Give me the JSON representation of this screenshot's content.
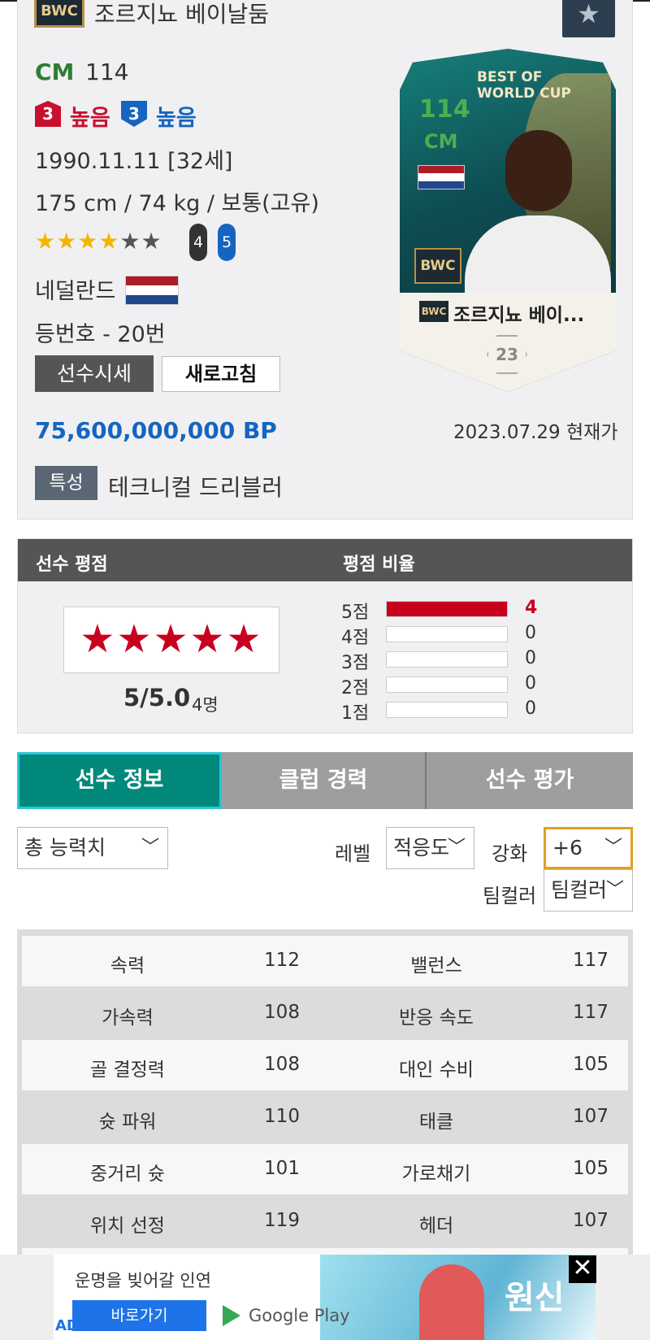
{
  "player": {
    "season_badge": "BWC",
    "name": "조르지뇨 베이날둠",
    "position": "CM",
    "ovr": "114",
    "work_rate_attack": {
      "level": "3",
      "label": "높음"
    },
    "work_rate_defense": {
      "level": "3",
      "label": "높음"
    },
    "birth": "1990.11.11 [32세]",
    "physique": "175 cm / 74 kg / 보통(고유)",
    "skill_stars_filled": 4,
    "skill_stars_total": 6,
    "weak_foot_left": "4",
    "weak_foot_right": "5",
    "nationality": "네덜란드",
    "back_number": "등번호 - 20번",
    "price_button": "선수시세",
    "refresh_button": "새로고침",
    "price": "75,600,000,000 BP",
    "price_date": "2023.07.29 현재가",
    "trait_label": "특성",
    "trait_value": "테크니컬 드리블러"
  },
  "card": {
    "banner": "BEST OF WORLD CUP",
    "banner_line1": "BEST OF",
    "banner_line2": "WORLD CUP",
    "ovr": "114",
    "position": "CM",
    "logo": "BWC",
    "name_badge": "BWC",
    "short_name": "조르지뇨 베이...",
    "number": "23"
  },
  "rating": {
    "header_left": "선수 평점",
    "header_right": "평점 비율",
    "stars": "★★★★★",
    "score": "5/5.0",
    "count": "4명",
    "distribution": [
      {
        "label": "5점",
        "count": "4",
        "fraction": 1.0
      },
      {
        "label": "4점",
        "count": "0",
        "fraction": 0
      },
      {
        "label": "3점",
        "count": "0",
        "fraction": 0
      },
      {
        "label": "2점",
        "count": "0",
        "fraction": 0
      },
      {
        "label": "1점",
        "count": "0",
        "fraction": 0
      }
    ]
  },
  "tabs": [
    {
      "label": "선수 정보",
      "active": true
    },
    {
      "label": "클럽 경력",
      "active": false
    },
    {
      "label": "선수 평가",
      "active": false
    }
  ],
  "filters": {
    "ability_select": "총 능력치",
    "level_label": "레벨",
    "level_select": "적응도",
    "upgrade_label": "강화",
    "upgrade_select": "+6",
    "teamcolor_label": "팀컬러",
    "teamcolor_select": "팀컬러"
  },
  "stats": [
    {
      "name1": "속력",
      "val1": "112",
      "name2": "밸런스",
      "val2": "117"
    },
    {
      "name1": "가속력",
      "val1": "108",
      "name2": "반응 속도",
      "val2": "117"
    },
    {
      "name1": "골 결정력",
      "val1": "108",
      "name2": "대인 수비",
      "val2": "105"
    },
    {
      "name1": "슛 파워",
      "val1": "110",
      "name2": "태클",
      "val2": "107"
    },
    {
      "name1": "중거리 슛",
      "val1": "101",
      "name2": "가로채기",
      "val2": "105"
    },
    {
      "name1": "위치 선정",
      "val1": "119",
      "name2": "헤더",
      "val2": "107"
    }
  ],
  "ad": {
    "title": "운명을 빚어갈 인연",
    "button": "바로가기",
    "store": "Google Play",
    "logo": "원신",
    "mark": "AD",
    "close": "✕"
  },
  "colors": {
    "accent_green": "#2e7d32",
    "price_blue": "#1565c0",
    "rating_red": "#c8001e",
    "tab_active": "#00897b",
    "select_focus": "#e0a020"
  }
}
